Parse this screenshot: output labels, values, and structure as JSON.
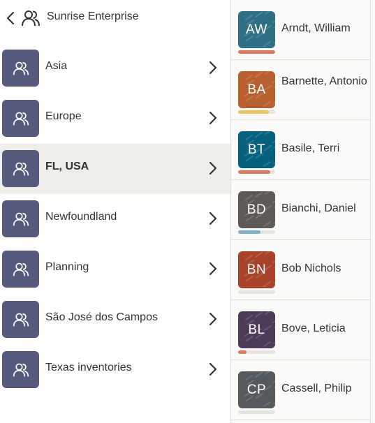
{
  "header": {
    "title": "Sunrise Enterprise",
    "back_icon": "chevron-left-icon",
    "group_icon": "people-icon"
  },
  "groups": [
    {
      "label": "Asia",
      "selected": false
    },
    {
      "label": "Europe",
      "selected": false
    },
    {
      "label": "FL, USA",
      "selected": true
    },
    {
      "label": "Newfoundland",
      "selected": false
    },
    {
      "label": "Planning",
      "selected": false
    },
    {
      "label": "São José dos Campos",
      "selected": false
    },
    {
      "label": "Texas inventories",
      "selected": false
    }
  ],
  "people": [
    {
      "initials": "AW",
      "name": "Arndt, William",
      "avatar_color": "#2f6f85",
      "progress": 1.0,
      "progress_color": "#d97a63"
    },
    {
      "initials": "BA",
      "name": "Barnette, Antonio",
      "avatar_color": "#b85f2f",
      "progress": 0.83,
      "progress_color": "#e8c660"
    },
    {
      "initials": "BT",
      "name": "Basile, Terri",
      "avatar_color": "#06617f",
      "progress": 0.87,
      "progress_color": "#d97a63"
    },
    {
      "initials": "BD",
      "name": "Bianchi, Daniel",
      "avatar_color": "#5e5954",
      "progress": 0.6,
      "progress_color": "#7eb1c9"
    },
    {
      "initials": "BN",
      "name": "Bob Nichols",
      "avatar_color": "#a8432a",
      "progress": 0.0,
      "progress_color": "#d97a63"
    },
    {
      "initials": "BL",
      "name": "Bove, Leticia",
      "avatar_color": "#4e3b58",
      "progress": 0.23,
      "progress_color": "#d97a63"
    },
    {
      "initials": "CP",
      "name": "Cassell, Philip",
      "avatar_color": "#55595c",
      "progress": 0.0,
      "progress_color": "#d97a63"
    }
  ],
  "colors": {
    "group_tile": "#565a7c",
    "selected_row": "#efeeeb",
    "divider": "#e2e0dd"
  }
}
